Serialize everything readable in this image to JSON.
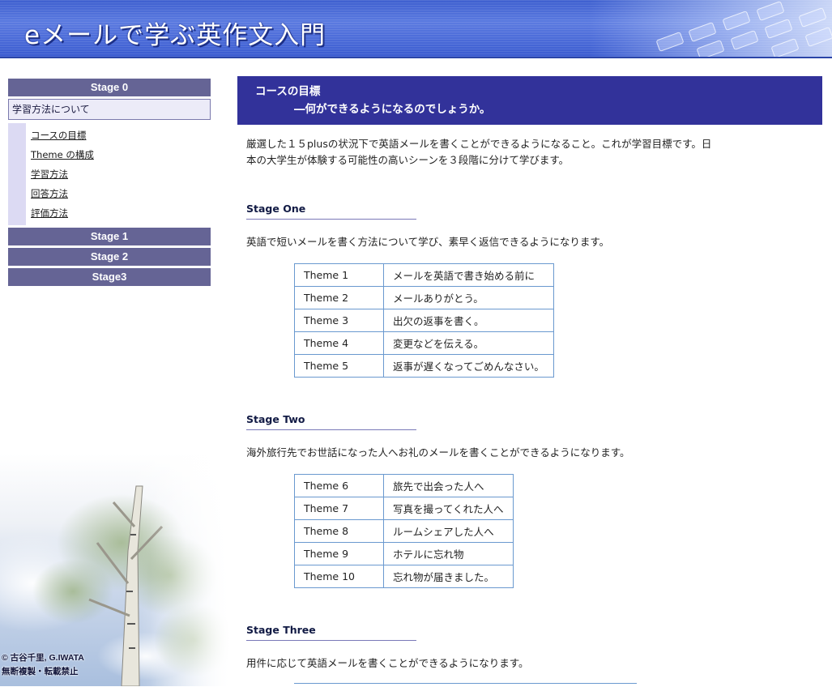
{
  "header": {
    "title": "eメールで学ぶ英作文入門"
  },
  "sidebar": {
    "stage0": "Stage 0",
    "section_label": "学習方法について",
    "links": [
      {
        "label": "コースの目標"
      },
      {
        "label": "Theme の構成"
      },
      {
        "label": "学習方法"
      },
      {
        "label": "回答方法"
      },
      {
        "label": "評価方法"
      }
    ],
    "stage1": "Stage 1",
    "stage2": "Stage 2",
    "stage3": "Stage3",
    "copyright_line1": "© 古谷千里, G.IWATA",
    "copyright_line2": "無断複製・転載禁止"
  },
  "main": {
    "title_line1": "コースの目標",
    "title_line2": "―何ができるようになるのでしょうか。",
    "intro_line1": "厳選した１５plusの状況下で英語メールを書くことができるようになること。これが学習目標です。日",
    "intro_line2": "本の大学生が体験する可能性の高いシーンを３段階に分けて学びます。",
    "stages": [
      {
        "heading": "Stage One",
        "desc": "英語で短いメールを書く方法について学び、素早く返信できるようになります。",
        "themes": [
          {
            "name": "Theme 1",
            "title": "メールを英語で書き始める前に"
          },
          {
            "name": "Theme 2",
            "title": "メールありがとう。"
          },
          {
            "name": "Theme 3",
            "title": "出欠の返事を書く。"
          },
          {
            "name": "Theme 4",
            "title": "変更などを伝える。"
          },
          {
            "name": "Theme 5",
            "title": "返事が遅くなってごめんなさい。"
          }
        ]
      },
      {
        "heading": "Stage Two",
        "desc": "海外旅行先でお世話になった人へお礼のメールを書くことができるようになります。",
        "themes": [
          {
            "name": "Theme 6",
            "title": "旅先で出会った人へ"
          },
          {
            "name": "Theme 7",
            "title": "写真を撮ってくれた人へ"
          },
          {
            "name": "Theme 8",
            "title": "ルームシェアした人へ"
          },
          {
            "name": "Theme 9",
            "title": "ホテルに忘れ物"
          },
          {
            "name": "Theme 10",
            "title": "忘れ物が届きました。"
          }
        ]
      },
      {
        "heading": "Stage Three",
        "desc": "用件に応じて英語メールを書くことができるようになります。"
      }
    ]
  },
  "colors": {
    "header_blue": "#3d5fcf",
    "nav_purple": "#656495",
    "title_bar_navy": "#32329a",
    "table_border": "#6a99cf"
  }
}
